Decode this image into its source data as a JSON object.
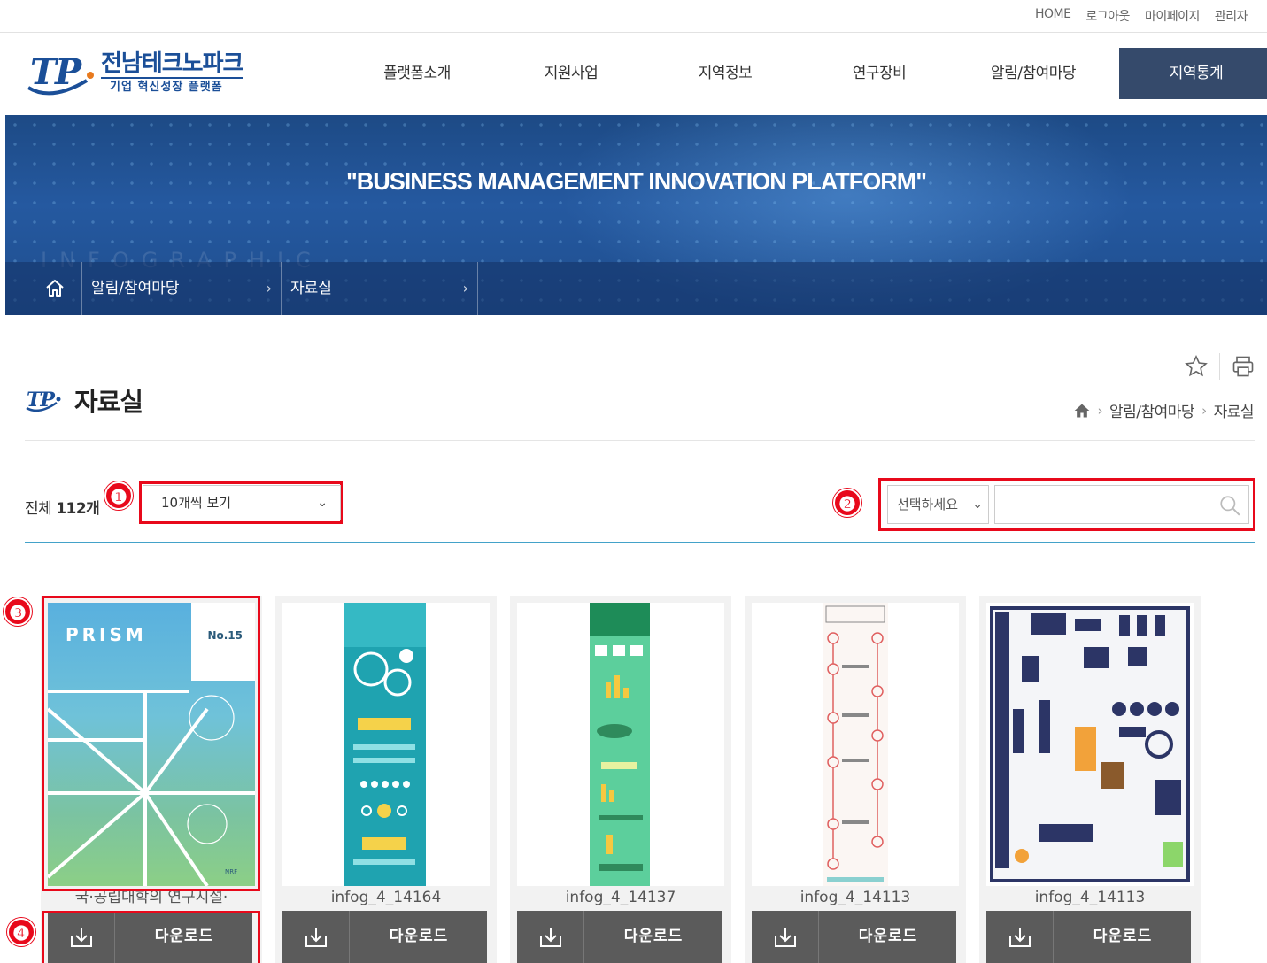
{
  "util_links": [
    "HOME",
    "로그아웃",
    "마이페이지",
    "관리자"
  ],
  "logo": {
    "name": "전남테크노파크",
    "tagline": "기업 혁신성장 플랫폼"
  },
  "nav": [
    "플랫폼소개",
    "지원사업",
    "지역정보",
    "연구장비",
    "알림/참여마당",
    "지역통계"
  ],
  "banner": {
    "slogan": "\"BUSINESS MANAGEMENT INNOVATION PLATFORM\"",
    "watermark": "INFOGRAPHIC",
    "crumb1": "알림/참여마당",
    "crumb2": "자료실"
  },
  "page": {
    "title": "자료실",
    "location": [
      "알림/참여마당",
      "자료실"
    ]
  },
  "list": {
    "total_label": "전체",
    "total_count": "112개",
    "per_page": "10개씩 보기",
    "search_select": "선택하세요",
    "search_value": ""
  },
  "badges": [
    "❶",
    "❷",
    "❸",
    "❹"
  ],
  "cards": [
    {
      "name": "국·공립대학의 연구시설·",
      "cover_title": "PRISM",
      "cover_no": "No.15",
      "cover_brand": "NRF"
    },
    {
      "name": "infog_4_14164"
    },
    {
      "name": "infog_4_14137"
    },
    {
      "name": "infog_4_14113"
    },
    {
      "name": "infog_4_14113"
    }
  ],
  "download_label": "다운로드",
  "colors": {
    "nav_active": "#354a6b",
    "accent_line": "#43a2c9",
    "annotation": "#e8091b",
    "download_btn": "#5b5b5b"
  }
}
